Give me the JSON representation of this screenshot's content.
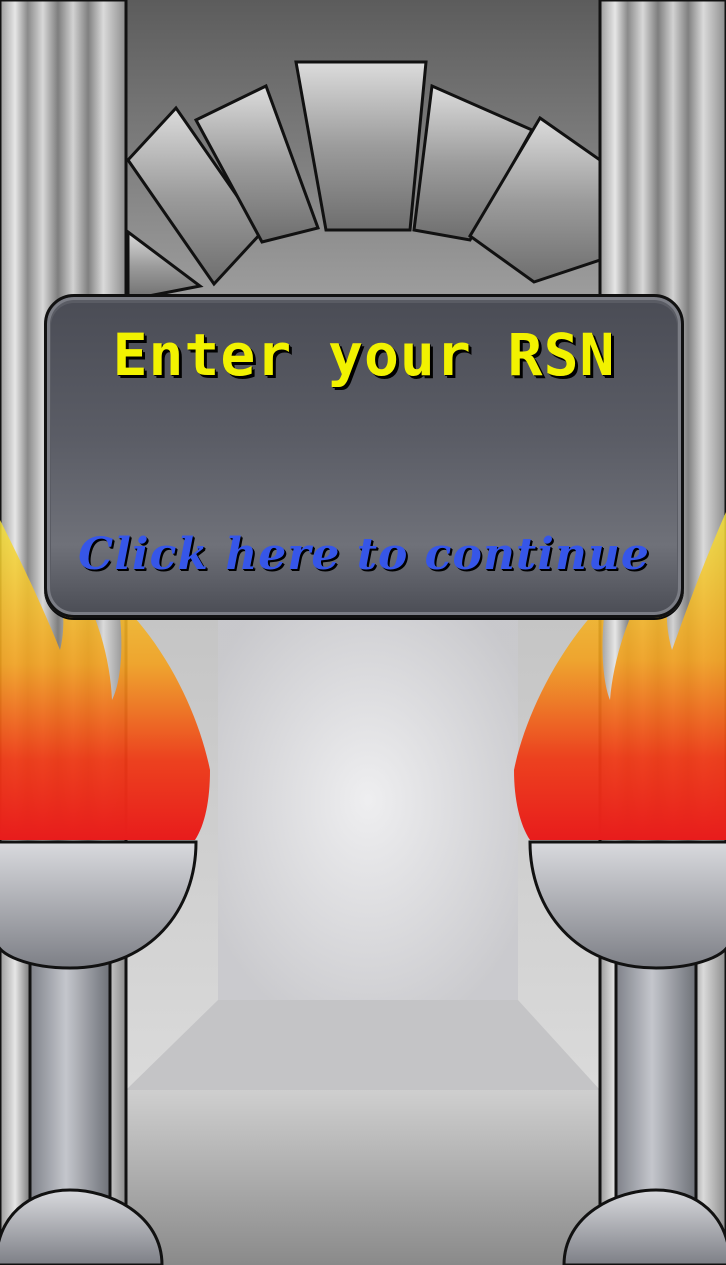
{
  "dialog": {
    "title": "Enter your RSN",
    "continue_label": "Click here to continue"
  },
  "colors": {
    "title_text": "#f2f200",
    "continue_text": "#3656e8",
    "dialog_background": "#55575f",
    "flame_red": "#e81c1c",
    "flame_yellow": "#f4e23a"
  }
}
